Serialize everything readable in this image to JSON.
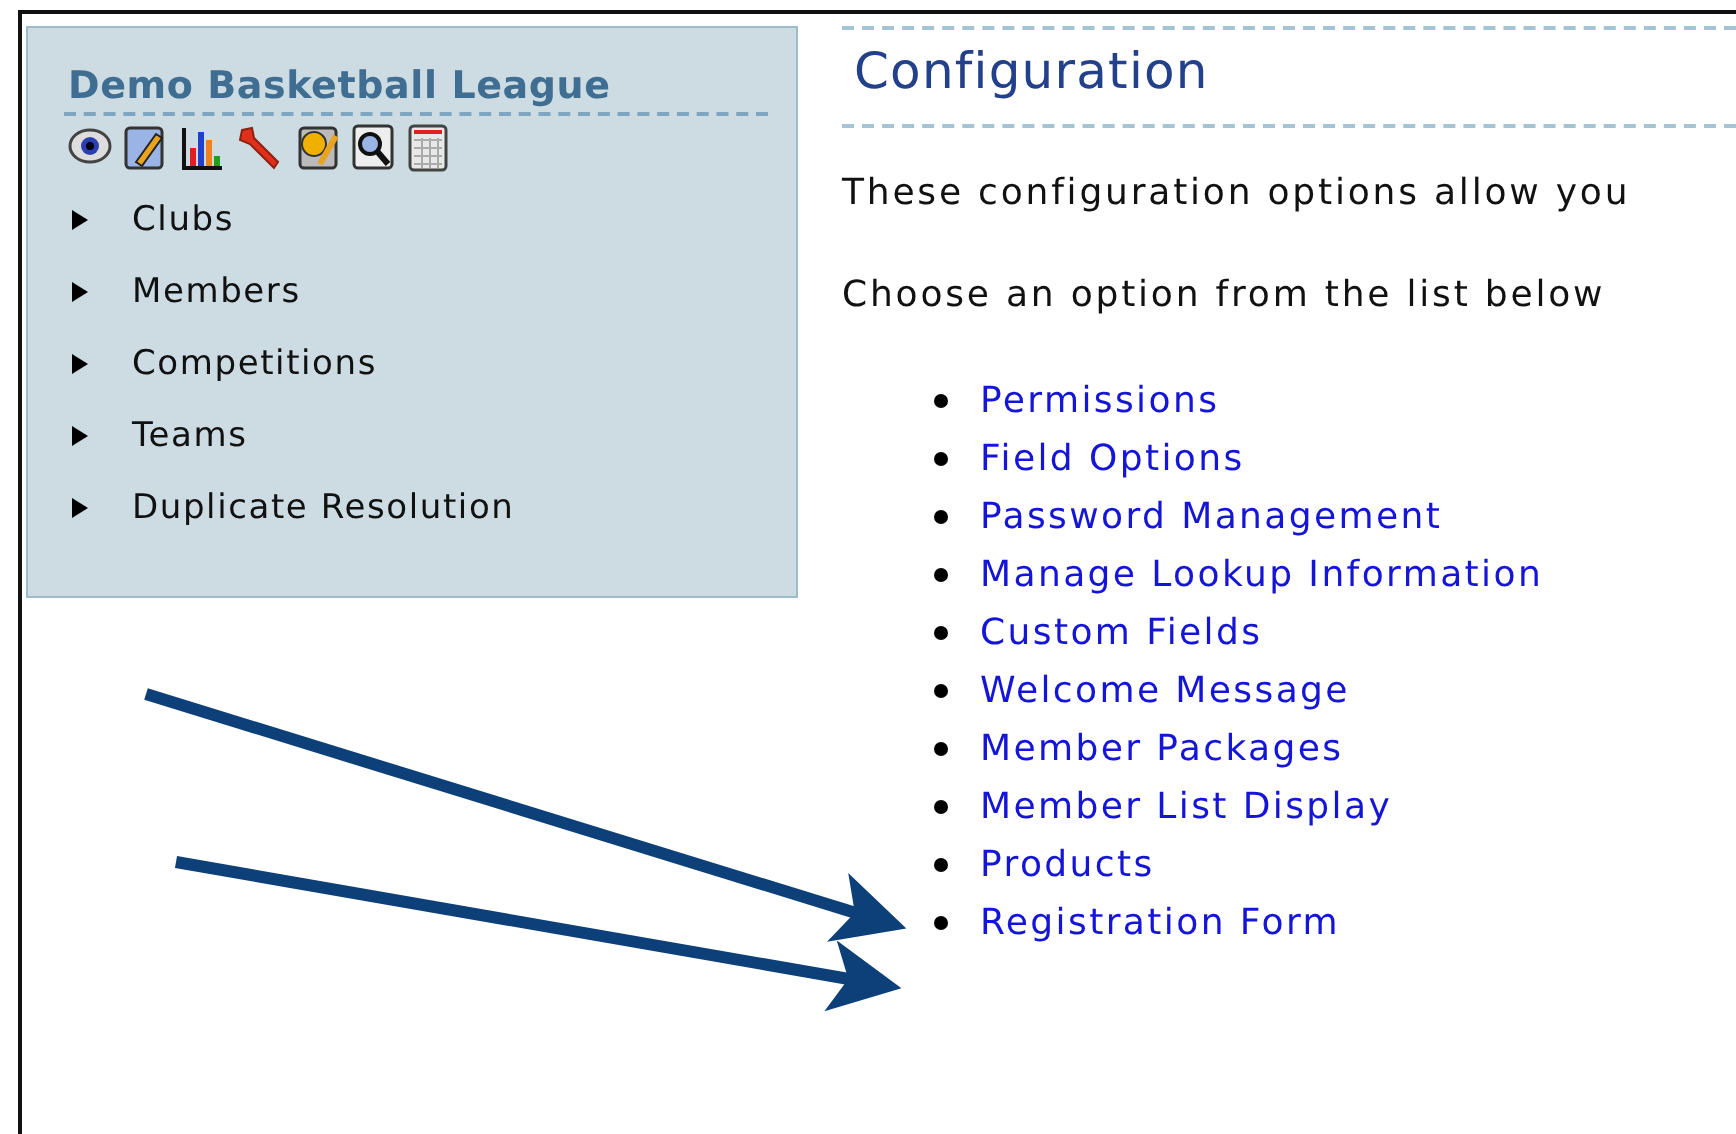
{
  "sidebar": {
    "title": "Demo Basketball League",
    "items": [
      "Clubs",
      "Members",
      "Competitions",
      "Teams",
      "Duplicate Resolution"
    ]
  },
  "content": {
    "title": "Configuration",
    "paragraphs": [
      "These configuration options allow you",
      "Choose an option from the list below"
    ],
    "options": [
      "Permissions",
      "Field Options",
      "Password Management",
      "Manage Lookup Information",
      "Custom Fields",
      "Welcome Message",
      "Member Packages",
      "Member List Display",
      "Products",
      "Registration Form"
    ]
  }
}
